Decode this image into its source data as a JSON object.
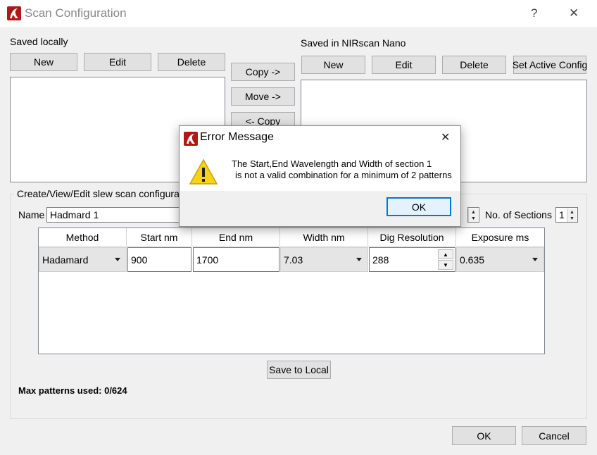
{
  "window": {
    "title": "Scan Configuration",
    "help_glyph": "?",
    "close_glyph": "✕"
  },
  "local": {
    "label": "Saved locally",
    "new": "New",
    "edit": "Edit",
    "delete": "Delete"
  },
  "transfer": {
    "copy_right": "Copy ->",
    "move_right": "Move ->",
    "copy_left": "<- Copy"
  },
  "nano": {
    "label": "Saved in NIRscan Nano",
    "new": "New",
    "edit": "Edit",
    "delete": "Delete",
    "set_active": "Set Active Config"
  },
  "config": {
    "group_label": "Create/View/Edit  slew scan configuratio",
    "name_label": "Name",
    "name_value": "Hadmard 1",
    "sections_label": "No. of Sections",
    "sections_value": "1",
    "table": {
      "headers": [
        "Method",
        "Start nm",
        "End nm",
        "Width nm",
        "Dig Resolution",
        "Exposure ms"
      ],
      "row": {
        "method": "Hadamard",
        "start": "900",
        "end": "1700",
        "width": "7.03",
        "dig_resolution": "288",
        "exposure": "0.635"
      }
    },
    "save_to_local": "Save to Local",
    "max_patterns": "Max patterns used: 0/624"
  },
  "footer": {
    "ok": "OK",
    "cancel": "Cancel"
  },
  "error_dialog": {
    "title": "Error Message",
    "close_glyph": "✕",
    "line1": "The Start,End Wavelength and Width of section 1",
    "line2": "is not a valid combination for a minimum of 2 patterns",
    "ok": "OK",
    "icon": "warning-icon"
  },
  "colors": {
    "accent": "#0078d7",
    "warning": "#f7d21b",
    "app_icon": "#b01818"
  }
}
